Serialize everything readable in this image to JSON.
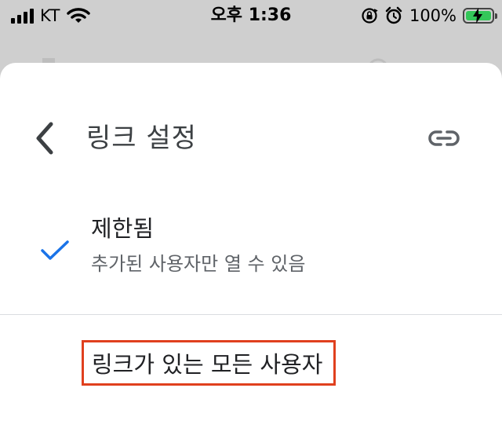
{
  "status_bar": {
    "carrier": "KT",
    "time": "오후 1:36",
    "battery_percent": "100%"
  },
  "sheet": {
    "title": "링크 설정",
    "options": [
      {
        "title": "제한됨",
        "description": "추가된 사용자만 열 수 있음",
        "selected": true
      },
      {
        "title": "링크가 있는 모든 사용자",
        "selected": false
      }
    ]
  },
  "icons": {
    "back": "chevron-left-icon",
    "link": "link-icon",
    "check": "check-icon"
  },
  "colors": {
    "accent": "#1a73e8",
    "highlight_border": "#e0401e",
    "battery_fill": "#34c759"
  }
}
